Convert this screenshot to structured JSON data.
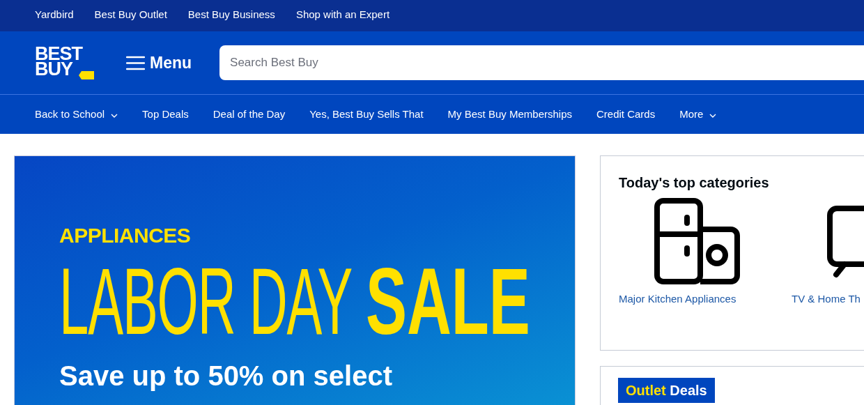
{
  "top_links": [
    "Yardbird",
    "Best Buy Outlet",
    "Best Buy Business",
    "Shop with an Expert"
  ],
  "header": {
    "logo": {
      "line_1": "BEST",
      "line_2": "BUY"
    },
    "menu_label": "Menu",
    "search": {
      "placeholder": "Search Best Buy"
    }
  },
  "nav": [
    {
      "label": "Back to School",
      "has_menu": true
    },
    {
      "label": "Top Deals",
      "has_menu": false
    },
    {
      "label": "Deal of the Day",
      "has_menu": false
    },
    {
      "label": "Yes, Best Buy Sells That",
      "has_menu": false
    },
    {
      "label": "My Best Buy Memberships",
      "has_menu": false
    },
    {
      "label": "Credit Cards",
      "has_menu": false
    },
    {
      "label": "More",
      "has_menu": true
    }
  ],
  "banner": {
    "eyebrow": "APPLIANCES",
    "headline_light": "LABOR DAY",
    "headline_bold": "SALE",
    "subline": "Save up to 50% on select"
  },
  "top_categories": {
    "title": "Today's top categories",
    "items": [
      {
        "label": "Major Kitchen Appliances",
        "kind": "appliances"
      },
      {
        "label": "TV & Home Th",
        "kind": "tv"
      }
    ]
  },
  "outlet_card": {
    "badge_highlight": "Outlet",
    "badge_text": "Deals"
  }
}
